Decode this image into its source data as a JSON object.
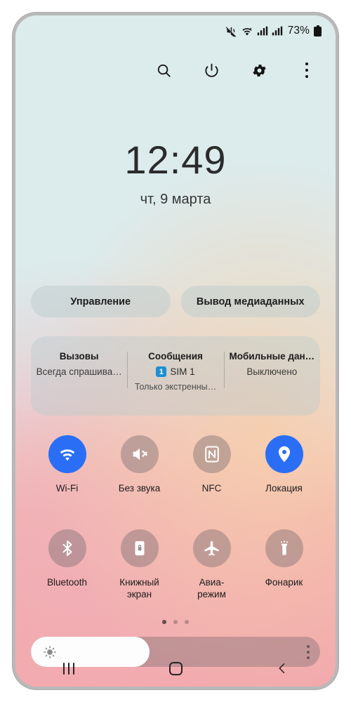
{
  "status_bar": {
    "icons": [
      "mute-icon",
      "wifi-icon",
      "signal-sim1-icon",
      "signal-sim2-icon"
    ],
    "battery_percent": "73%"
  },
  "toolbar": {
    "search_label": "search-icon",
    "power_label": "power-icon",
    "settings_label": "gear-icon",
    "overflow_label": "more-options-icon"
  },
  "clock": {
    "time": "12:49",
    "date": "чт, 9 марта"
  },
  "pills": [
    {
      "label": "Управление"
    },
    {
      "label": "Вывод медиаданных"
    }
  ],
  "sim_card": {
    "columns": [
      {
        "title": "Вызовы",
        "sub": "Всегда спрашива…",
        "sub2": "",
        "badge": ""
      },
      {
        "title": "Сообщения",
        "sub": "SIM 1",
        "sub2": "Только экстренны…",
        "badge": "1"
      },
      {
        "title": "Мобильные дан…",
        "sub": "Выключено",
        "sub2": "",
        "badge": ""
      }
    ]
  },
  "toggles": {
    "row1": [
      {
        "label": "Wi-Fi",
        "icon": "wifi-icon",
        "state": "on"
      },
      {
        "label": "Без звука",
        "icon": "mute-icon",
        "state": "off"
      },
      {
        "label": "NFC",
        "icon": "nfc-icon",
        "state": "off"
      },
      {
        "label": "Локация",
        "icon": "location-pin-icon",
        "state": "on"
      }
    ],
    "row2": [
      {
        "label": "Bluetooth",
        "icon": "bluetooth-icon",
        "state": "off"
      },
      {
        "label": "Книжный\nэкран",
        "icon": "rotation-lock-icon",
        "state": "off"
      },
      {
        "label": "Авиа-\nрежим",
        "icon": "airplane-icon",
        "state": "off"
      },
      {
        "label": "Фонарик",
        "icon": "flashlight-icon",
        "state": "off"
      }
    ]
  },
  "page_dots": {
    "count": 3,
    "active_index": 0
  },
  "brightness": {
    "value_percent": 41,
    "sun_icon": "brightness-sun-icon",
    "menu_icon": "more-options-icon"
  },
  "navbar": {
    "recents_label": "recents-icon",
    "home_label": "home-icon",
    "back_label": "back-icon"
  },
  "colors": {
    "accent_blue": "#2a6ef5",
    "sim_badge_blue": "#1a8fd4",
    "screen_top": "#dcebec",
    "screen_bottom": "#f2a9ad",
    "frame": "#b9b9b9"
  }
}
